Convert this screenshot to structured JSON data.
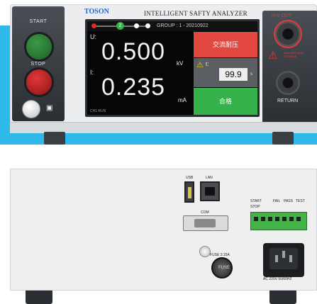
{
  "front": {
    "brand": "TOSON",
    "title": "INTELLIGENT SAFTY ANALYZER",
    "left_panel": {
      "start_label": "START",
      "stop_label": "STOP"
    },
    "screen": {
      "group": "GROUP : 1 - 20210922",
      "step_number": "2",
      "voltage_label": "U:",
      "voltage_value": "0.500",
      "voltage_unit": "kV",
      "current_label": "I:",
      "current_value": "0.235",
      "current_unit": "mA",
      "mode_label": "交流耐压",
      "time_label": "t:",
      "time_value": "99.9",
      "time_unit": "s",
      "result_label": "合格",
      "footer": "CH1 RUN"
    },
    "right_panel": {
      "hv_label": "H.V OUT",
      "warning_text": "DANGER HIGH VOLTAGE",
      "return_label": "RETURN"
    }
  },
  "rear": {
    "usb_label": "USB",
    "lan_label": "LAN",
    "com_label": "COM",
    "terminal_labels": [
      "START",
      "STOP",
      "FAIL",
      "PASS",
      "TEST"
    ],
    "fuse_label": "FUSE 3.15A",
    "fuse_text": "FUSE",
    "ac_label": "AC 220V 50/60HZ"
  },
  "colors": {
    "background": "#2fb8ea",
    "start": "#2e7d36",
    "stop": "#c8262a",
    "mode_red": "#e24740",
    "pass_green": "#35b34a"
  }
}
